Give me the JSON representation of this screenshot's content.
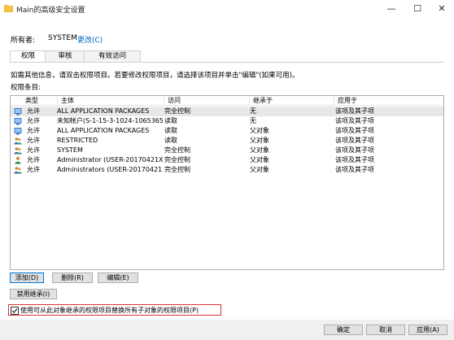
{
  "window": {
    "title": "Main的高级安全设置",
    "controls": [
      "—",
      "☐",
      "✕"
    ]
  },
  "owner": {
    "label": "所有者:",
    "value": "SYSTEM",
    "change": "更改(C)"
  },
  "tabs": [
    {
      "label": "权限",
      "active": true
    },
    {
      "label": "审核",
      "active": false
    },
    {
      "label": "有效访问",
      "active": false
    }
  ],
  "description": "如需其他信息，请双击权限项目。若要修改权限项目，请选择该项目并单击\"编辑\"(如果可用)。",
  "entries_label": "权限条目:",
  "table": {
    "headers": [
      "类型",
      "主体",
      "访问",
      "继承于",
      "应用于"
    ],
    "rows": [
      {
        "icon": "app-package-icon",
        "type": "允许",
        "principal": "ALL APPLICATION PACKAGES",
        "access": "完全控制",
        "inherited": "无",
        "applies": "该项及其子项",
        "selected": true
      },
      {
        "icon": "unknown-account-icon",
        "type": "允许",
        "principal": "未知帐户(S-1-15-3-1024-1065365...",
        "access": "读取",
        "inherited": "无",
        "applies": "该项及其子项",
        "selected": false
      },
      {
        "icon": "app-package-icon",
        "type": "允许",
        "principal": "ALL APPLICATION PACKAGES",
        "access": "读取",
        "inherited": "父对象",
        "applies": "该项及其子项",
        "selected": false
      },
      {
        "icon": "group-icon",
        "type": "允许",
        "principal": "RESTRICTED",
        "access": "读取",
        "inherited": "父对象",
        "applies": "该项及其子项",
        "selected": false
      },
      {
        "icon": "group-icon",
        "type": "允许",
        "principal": "SYSTEM",
        "access": "完全控制",
        "inherited": "父对象",
        "applies": "该项及其子项",
        "selected": false
      },
      {
        "icon": "user-icon",
        "type": "允许",
        "principal": "Administrator (USER-20170421X...",
        "access": "完全控制",
        "inherited": "父对象",
        "applies": "该项及其子项",
        "selected": false
      },
      {
        "icon": "group-icon",
        "type": "允许",
        "principal": "Administrators (USER-20170421...",
        "access": "完全控制",
        "inherited": "父对象",
        "applies": "该项及其子项",
        "selected": false
      }
    ]
  },
  "buttons": {
    "add": "添加(D)",
    "remove": "删除(R)",
    "edit": "编辑(E)",
    "disable_inheritance": "禁用继承(I)",
    "ok": "确定",
    "cancel": "取消",
    "apply": "应用(A)"
  },
  "replace_checkbox": {
    "label": "使用可从此对象继承的权限项目替换所有子对象的权限项目(P)",
    "checked": true
  },
  "colors": {
    "link": "#0066cc",
    "highlight_border": "#e03030",
    "focus": "#0078d7"
  }
}
